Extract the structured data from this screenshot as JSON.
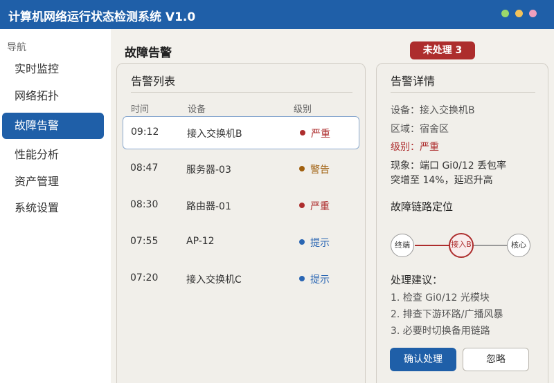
{
  "app": {
    "title": "计算机网络运行状态检测系统 V1.0",
    "window_dots": [
      "#9bd86b",
      "#f3c25a",
      "#ef9fbd"
    ]
  },
  "sidebar": {
    "heading": "导航",
    "items": [
      {
        "label": "实时监控",
        "active": false
      },
      {
        "label": "网络拓扑",
        "active": false
      },
      {
        "label": "故障告警",
        "active": true
      },
      {
        "label": "性能分析",
        "active": false
      },
      {
        "label": "资产管理",
        "active": false
      },
      {
        "label": "系统设置",
        "active": false
      }
    ]
  },
  "page": {
    "title": "故障告警",
    "badge": "未处理 3"
  },
  "alarm_list": {
    "title": "告警列表",
    "columns": [
      "时间",
      "设备",
      "级别"
    ],
    "rows": [
      {
        "time": "09:12",
        "device": "接入交换机B",
        "level": "严重",
        "level_color": "#ad2d2d",
        "selected": true
      },
      {
        "time": "08:47",
        "device": "服务器-03",
        "level": "警告",
        "level_color": "#a0600f",
        "selected": false
      },
      {
        "time": "08:30",
        "device": "路由器-01",
        "level": "严重",
        "level_color": "#ad2d2d",
        "selected": false
      },
      {
        "time": "07:55",
        "device": "AP-12",
        "level": "提示",
        "level_color": "#2a66b3",
        "selected": false
      },
      {
        "time": "07:20",
        "device": "接入交换机C",
        "level": "提示",
        "level_color": "#2a66b3",
        "selected": false
      }
    ]
  },
  "detail": {
    "title": "告警详情",
    "device": "设备：接入交换机B",
    "area": "区域：宿舍区",
    "level": "级别：严重",
    "symptom_line1": "现象：端口 Gi0/12 丢包率",
    "symptom_line2": "突增至 14%，延迟升高",
    "chain_title": "故障链路定位",
    "chain": {
      "nodes": [
        "终端",
        "接入B",
        "核心"
      ],
      "fault_link_color": "#ad2d2d",
      "normal_link_color": "#999999"
    },
    "suggestions_title": "处理建议：",
    "suggestions": [
      "1. 检查 Gi0/12 光模块",
      "2. 排查下游环路/广播风暴",
      "3. 必要时切换备用链路"
    ],
    "confirm_label": "确认处理",
    "ignore_label": "忽略"
  },
  "colors": {
    "primary": "#1f5fa8",
    "danger": "#ad2d2d",
    "warning": "#a0600f",
    "info": "#2a66b3",
    "panel_bg": "#f1efea"
  }
}
